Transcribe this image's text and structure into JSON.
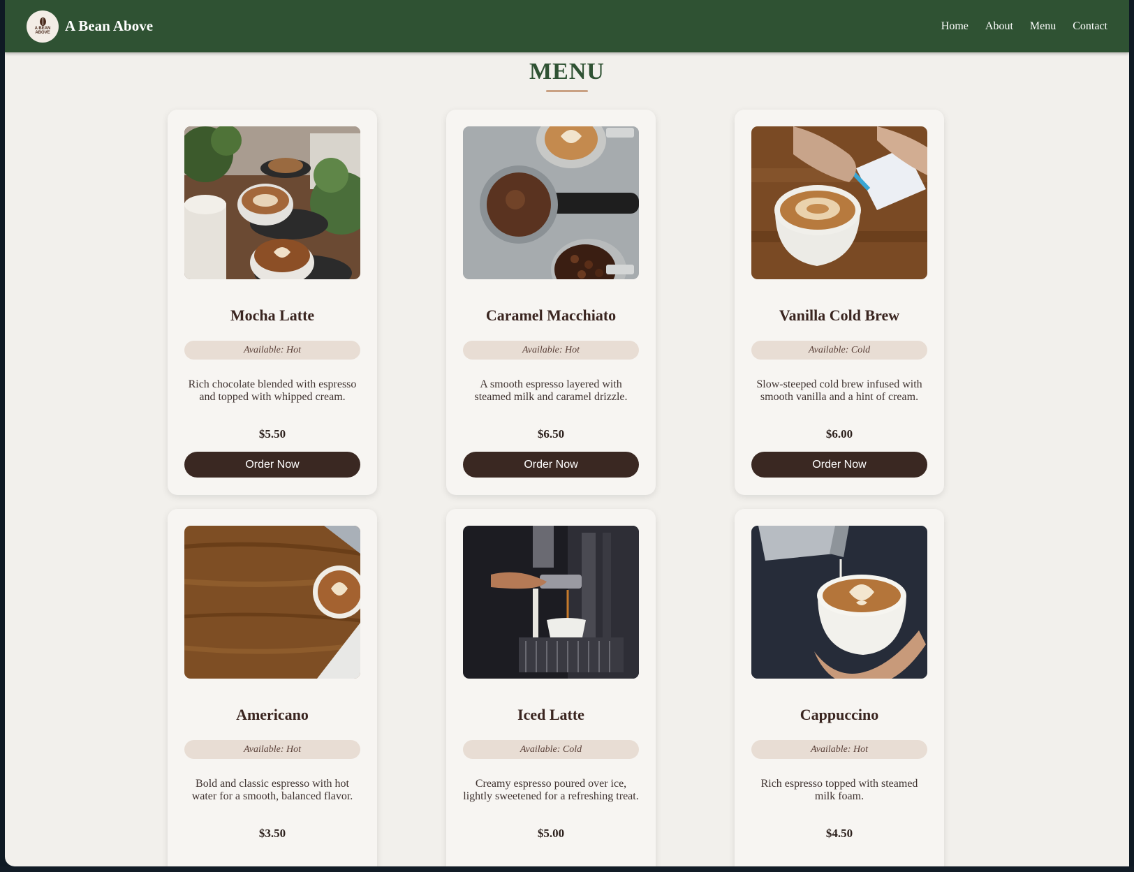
{
  "header": {
    "logo_text": "A BEAN ABOVE",
    "brand": "A Bean Above",
    "nav": [
      "Home",
      "About",
      "Menu",
      "Contact"
    ]
  },
  "page_title": "MENU",
  "cta_label": "Order Now",
  "colors": {
    "header_bg": "#2f5233",
    "page_bg": "#f2f0ec",
    "accent_underline": "#c9a183",
    "button_bg": "#3a2822",
    "badge_bg": "#e8ddd4"
  },
  "menu": [
    {
      "name": "Mocha Latte",
      "availability": "Available: Hot",
      "description": "Rich chocolate blended with espresso and topped with whipped cream.",
      "price": "$5.50",
      "image_icon": "latte-art-cups-photo"
    },
    {
      "name": "Caramel Macchiato",
      "availability": "Available: Hot",
      "description": "A smooth espresso layered with steamed milk and caramel drizzle.",
      "price": "$6.50",
      "image_icon": "portafilter-grounds-photo"
    },
    {
      "name": "Vanilla Cold Brew",
      "availability": "Available: Cold",
      "description": "Slow-steeped cold brew infused with smooth vanilla and a hint of cream.",
      "price": "$6.00",
      "image_icon": "coffee-cup-notebook-photo"
    },
    {
      "name": "Americano",
      "availability": "Available: Hot",
      "description": "Bold and classic espresso with hot water for a smooth, balanced flavor.",
      "price": "$3.50",
      "image_icon": "coffee-on-wood-table-photo"
    },
    {
      "name": "Iced Latte",
      "availability": "Available: Cold",
      "description": "Creamy espresso poured over ice, lightly sweetened for a refreshing treat.",
      "price": "$5.00",
      "image_icon": "espresso-machine-photo"
    },
    {
      "name": "Cappuccino",
      "availability": "Available: Hot",
      "description": "Rich espresso topped with steamed milk foam.",
      "price": "$4.50",
      "image_icon": "milk-pour-latte-art-photo"
    }
  ]
}
